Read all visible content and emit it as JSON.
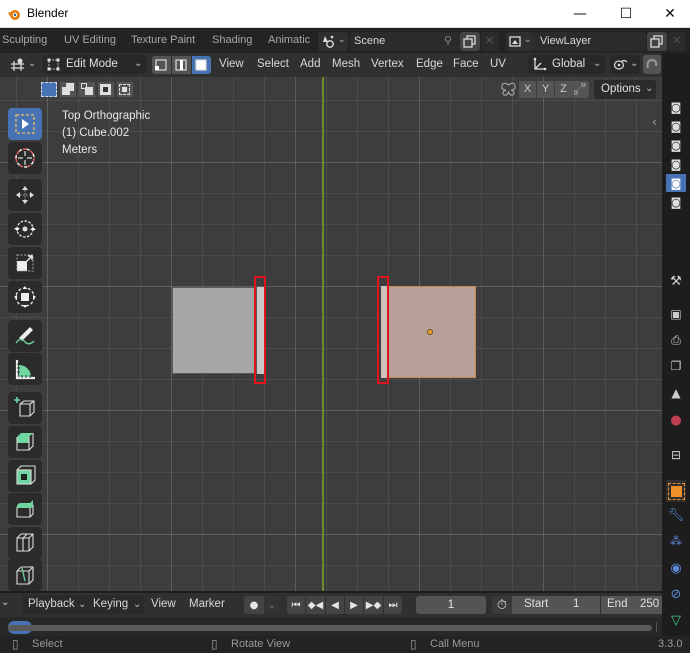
{
  "window": {
    "title": "Blender",
    "controls": {
      "minimize": "—",
      "maximize": "☐",
      "close": "✕"
    }
  },
  "workspaces": {
    "tabs": [
      {
        "label": "Sculpting"
      },
      {
        "label": "UV Editing"
      },
      {
        "label": "Texture Paint"
      },
      {
        "label": "Shading"
      },
      {
        "label": "Animatic"
      }
    ],
    "scene": {
      "value": "Scene"
    },
    "view_layer": {
      "value": "ViewLayer"
    }
  },
  "viewport_header": {
    "mode": "Edit Mode",
    "select_modes": [
      "vertex",
      "edge",
      "face"
    ],
    "active_select_mode": "face",
    "menus": [
      "View",
      "Select",
      "Add",
      "Mesh",
      "Vertex",
      "Edge",
      "Face",
      "UV"
    ],
    "transform_orientation": "Global",
    "axis_toggles": [
      "X",
      "Y",
      "Z"
    ],
    "options_label": "Options"
  },
  "viewport_overlay": {
    "view_name": "Top Orthographic",
    "object_name": "(1) Cube.002",
    "units": "Meters"
  },
  "tools": [
    {
      "name": "select-box",
      "active": true
    },
    {
      "name": "cursor",
      "active": false
    },
    {
      "name": "move",
      "active": false
    },
    {
      "name": "rotate",
      "active": false
    },
    {
      "name": "scale",
      "active": false
    },
    {
      "name": "transform",
      "active": false
    },
    {
      "name": "annotate",
      "active": false
    },
    {
      "name": "measure",
      "active": false
    },
    {
      "name": "add-cube",
      "active": false
    },
    {
      "name": "extrude-region",
      "active": false
    },
    {
      "name": "inset-faces",
      "active": false
    },
    {
      "name": "bevel",
      "active": false
    },
    {
      "name": "loop-cut",
      "active": false
    },
    {
      "name": "knife",
      "active": false
    }
  ],
  "properties_tabs": [
    "tool",
    "render",
    "output",
    "view-layer",
    "scene",
    "world",
    "collection",
    "object",
    "modifiers",
    "particles",
    "physics",
    "constraints",
    "data"
  ],
  "timeline": {
    "menus": [
      "Playback",
      "Keying",
      "View",
      "Marker"
    ],
    "current_frame": "1",
    "start_label": "Start",
    "start_value": "1",
    "end_label": "End",
    "end_value": "250"
  },
  "statusbar": {
    "left_action": "Select",
    "middle_action": "Rotate View",
    "right_action": "Call Menu",
    "version": "3.3.0"
  },
  "colors": {
    "accent": "#4772b3",
    "selection_highlight": "#e0141e",
    "y_axis": "#6d8c2f",
    "selected_object": "#b8a09a",
    "unselected_object": "#a6a6a6"
  }
}
